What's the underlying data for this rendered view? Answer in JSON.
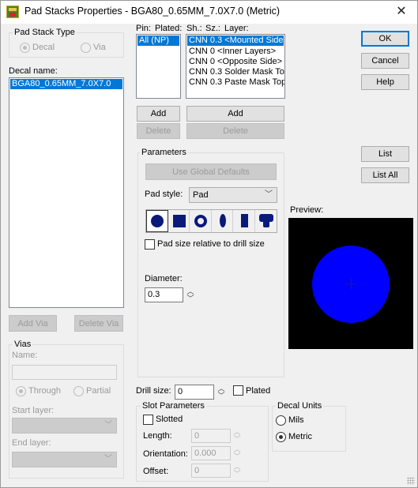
{
  "window": {
    "title": "Pad Stacks Properties - BGA80_0.65MM_7.0X7.0 (Metric)",
    "close_glyph": "✕"
  },
  "pad_stack_type": {
    "label": "Pad Stack Type",
    "options": [
      "Decal",
      "Via"
    ],
    "selected": "Decal"
  },
  "decal": {
    "label": "Decal name:",
    "items": [
      "BGA80_0.65MM_7.0X7.0"
    ],
    "add_via": "Add Via",
    "delete_via": "Delete Via"
  },
  "vias": {
    "label": "Vias",
    "name_label": "Name:",
    "name_value": "",
    "through": "Through",
    "partial": "Partial",
    "start_layer_label": "Start layer:",
    "end_layer_label": "End layer:"
  },
  "pins": {
    "header_pin": "Pin:",
    "header_plated": "Plated:",
    "items": [
      "All (NP)"
    ],
    "add": "Add",
    "delete": "Delete"
  },
  "layers": {
    "header_sh": "Sh.:",
    "header_sz": "Sz.:",
    "header_layer": "Layer:",
    "items": [
      "CNN 0.3 <Mounted Side>",
      "CNN 0 <Inner Layers>",
      "CNN 0 <Opposite Side>",
      "CNN 0.3 Solder Mask Top",
      "CNN 0.3 Paste Mask Top"
    ],
    "add": "Add",
    "delete": "Delete"
  },
  "parameters": {
    "label": "Parameters",
    "use_global": "Use Global Defaults",
    "pad_style_label": "Pad style:",
    "pad_style_value": "Pad",
    "shapes": [
      "round-pad-icon",
      "square-pad-icon",
      "annular-pad-icon",
      "oval-pad-icon",
      "rectangle-pad-icon",
      "odd-pad-icon"
    ],
    "relative_label": "Pad size relative to drill size",
    "diameter_label": "Diameter:",
    "diameter_value": "0.3"
  },
  "drill": {
    "size_label": "Drill size:",
    "size_value": "0",
    "plated_label": "Plated"
  },
  "slot": {
    "label": "Slot Parameters",
    "slotted": "Slotted",
    "length_label": "Length:",
    "length_value": "0",
    "orientation_label": "Orientation:",
    "orientation_value": "0.000",
    "offset_label": "Offset:",
    "offset_value": "0"
  },
  "decal_units": {
    "label": "Decal Units",
    "mils": "Mils",
    "metric": "Metric",
    "selected": "Metric"
  },
  "buttons": {
    "ok": "OK",
    "cancel": "Cancel",
    "help": "Help",
    "list": "List",
    "list_all": "List All"
  },
  "preview": {
    "label": "Preview:",
    "pad_color": "#0000ff",
    "background": "#000000"
  },
  "colors": {
    "selection": "#0078d7",
    "accent": "#0078d7"
  }
}
